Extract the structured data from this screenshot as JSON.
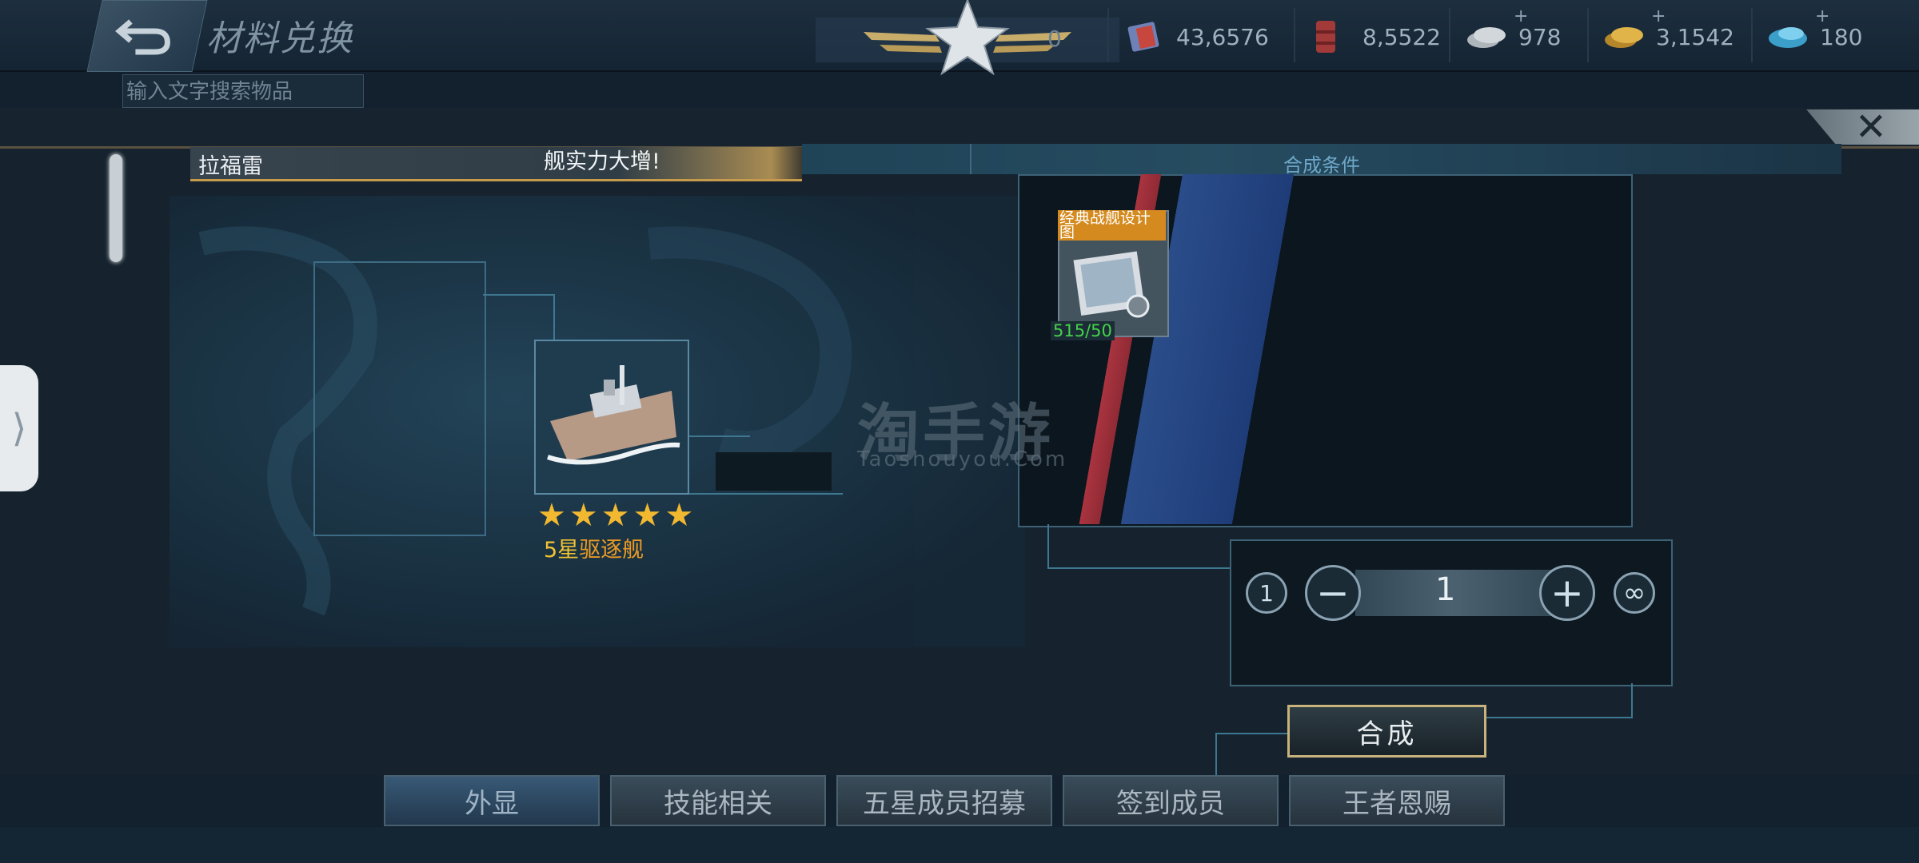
{
  "header": {
    "title": "材料兑换",
    "search_placeholder": "输入文字搜索物品",
    "resources": [
      {
        "icon": "flag-resource-icon",
        "value": "0"
      },
      {
        "icon": "supply-crate-icon",
        "value": "43,6576"
      },
      {
        "icon": "fuel-barrel-icon",
        "value": "8,5522"
      },
      {
        "icon": "silver-coins-icon",
        "value": "978"
      },
      {
        "icon": "gold-coins-icon",
        "value": "3,1542"
      },
      {
        "icon": "blue-gems-icon",
        "value": "180"
      }
    ],
    "plus": "+"
  },
  "modal": {
    "close": "✕",
    "ship_name": "拉福雷",
    "slogan": "舰实力大增!",
    "conditions_label": "合成条件",
    "stars_count": 5,
    "rank_star": "5星",
    "rank_type": "驱逐舰",
    "material": {
      "name": "经典战舰设计图",
      "count": "515/50"
    },
    "quantity": {
      "min": "1",
      "value": "1",
      "minus": "−",
      "plus": "+",
      "max": "∞"
    },
    "compose_label": "合成",
    "watermark": "淘手游",
    "watermark_sub": "Taoshouyou.Com"
  },
  "side_tab": "⟩",
  "tabs": [
    "外显",
    "技能相关",
    "五星成员招募",
    "签到成员",
    "王者恩赐"
  ]
}
